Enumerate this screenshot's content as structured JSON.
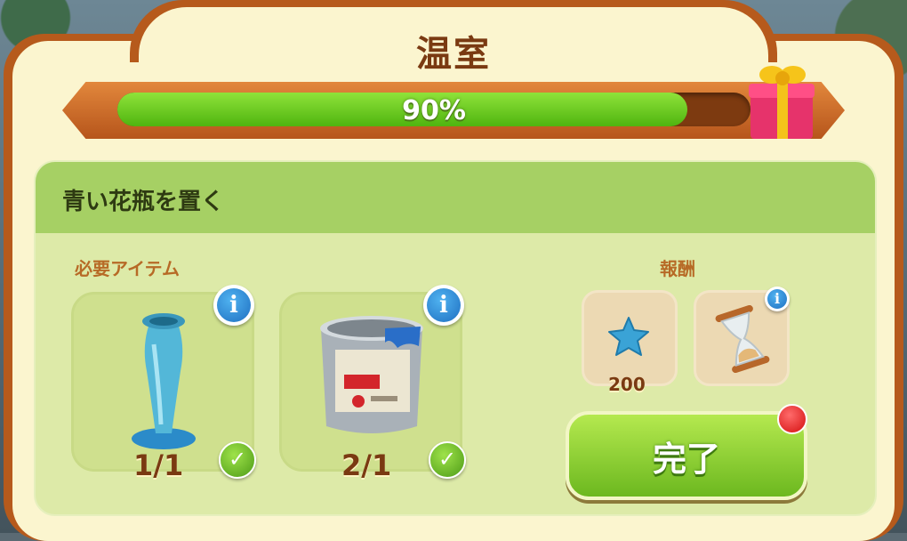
{
  "window": {
    "title": "温室"
  },
  "progress": {
    "label": "90%",
    "value": 0.9
  },
  "task": {
    "title": "青い花瓶を置く",
    "required_label": "必要アイテム",
    "reward_label": "報酬",
    "items": [
      {
        "name": "blue-vase",
        "count": "1/1",
        "icon": "vase-icon"
      },
      {
        "name": "paint-can",
        "count": "2/1",
        "icon": "paint-can-icon"
      }
    ],
    "rewards": [
      {
        "name": "star",
        "amount": "200",
        "icon": "star-icon"
      },
      {
        "name": "hourglass",
        "amount": "",
        "icon": "hourglass-icon"
      }
    ],
    "complete_button": "完了"
  },
  "colors": {
    "frame": "#b65a1c",
    "panel": "#fbf5cf",
    "progress_fill": "#6cc61f",
    "card": "#ddeaa8",
    "button": "#8fd535"
  }
}
